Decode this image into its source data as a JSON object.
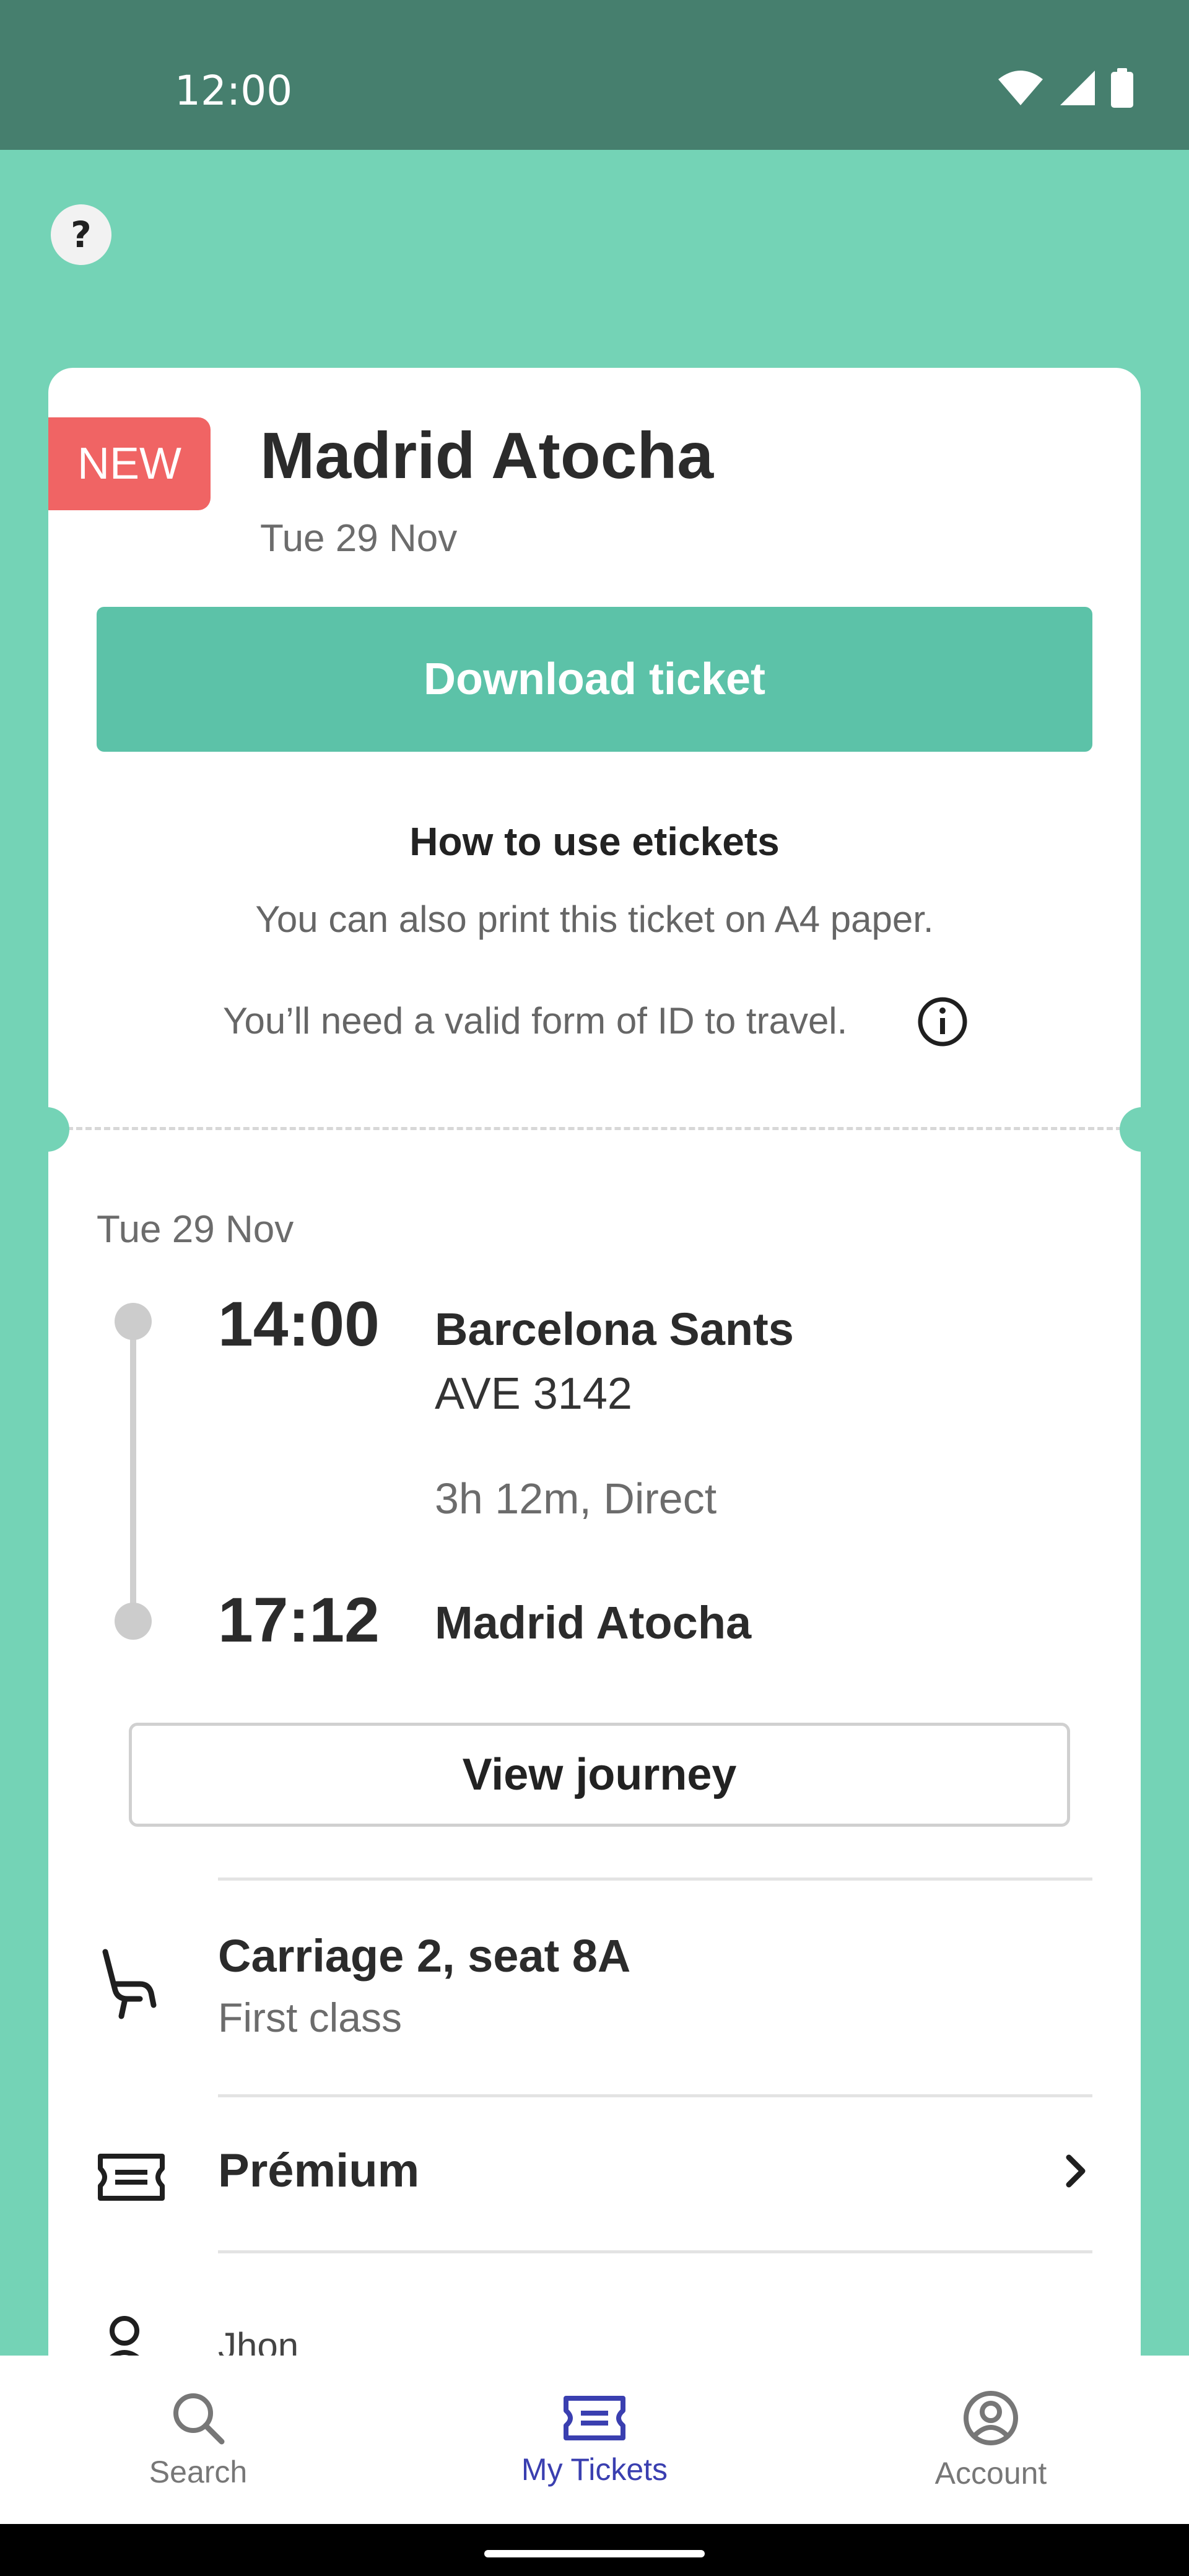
{
  "status_bar": {
    "time": "12:00"
  },
  "help": {
    "label": "?"
  },
  "ticket": {
    "badge": "NEW",
    "destination": "Madrid Atocha",
    "date": "Tue 29 Nov",
    "download_label": "Download ticket",
    "howto": {
      "title": "How to use etickets",
      "line1": "You can also print this ticket on A4 paper.",
      "line2": "You’ll need a valid form of ID to travel."
    },
    "journey": {
      "date": "Tue 29 Nov",
      "departure_time": "14:00",
      "departure_station": "Barcelona Sants",
      "train": "AVE 3142",
      "duration": "3h 12m, Direct",
      "arrival_time": "17:12",
      "arrival_station": "Madrid Atocha",
      "view_label": "View journey"
    },
    "seat": {
      "title": "Carriage 2, seat 8A",
      "class": "First class"
    },
    "fare": {
      "title": "Prémium"
    },
    "passenger": {
      "name": "Jhon"
    }
  },
  "bottom_nav": {
    "items": [
      {
        "label": "Search",
        "icon": "search-icon"
      },
      {
        "label": "My Tickets",
        "icon": "ticket-icon",
        "active": true
      },
      {
        "label": "Account",
        "icon": "account-icon"
      }
    ]
  },
  "colors": {
    "background": "#74d3b6",
    "status_bar": "#467f6e",
    "primary_button": "#5cc2a8",
    "badge": "#f06464",
    "nav_active": "#3a3fb0"
  }
}
